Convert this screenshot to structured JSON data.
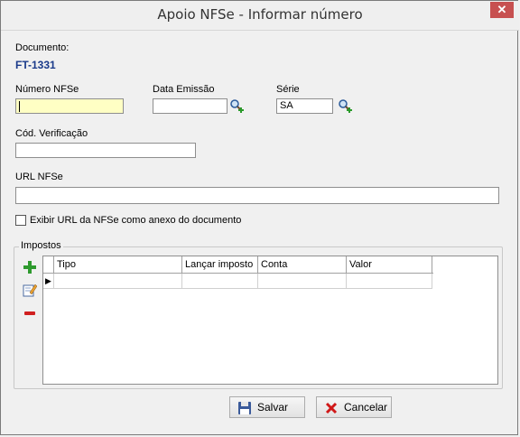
{
  "window": {
    "title": "Apoio NFSe - Informar número",
    "close_symbol": "✕"
  },
  "documento": {
    "label": "Documento:",
    "value": "FT-1331"
  },
  "numero_nfse": {
    "label": "Número NFSe",
    "value": ""
  },
  "data_emissao": {
    "label": "Data Emissão",
    "value": ""
  },
  "serie": {
    "label": "Série",
    "value": "SA"
  },
  "cod_verificacao": {
    "label": "Cód. Verificação",
    "value": ""
  },
  "url_nfse": {
    "label": "URL NFSe",
    "value": ""
  },
  "exibir_url": {
    "label": "Exibir URL da NFSe como anexo do documento",
    "checked": false
  },
  "impostos": {
    "label": "Impostos",
    "columns": [
      "Tipo",
      "Lançar imposto",
      "Conta",
      "Valor"
    ],
    "rows": [
      [
        "",
        "",
        "",
        ""
      ]
    ],
    "row_indicator": "▶"
  },
  "buttons": {
    "salvar": "Salvar",
    "cancelar": "Cancelar"
  },
  "colors": {
    "accent_text": "#1a3a8a",
    "focus_field": "#ffffc4",
    "close": "#c75050"
  },
  "icons": {
    "lookup": "magnifier-plus-icon",
    "add": "plus-icon",
    "edit": "edit-icon",
    "remove": "minus-icon",
    "save": "floppy-icon",
    "cancel": "red-x-icon"
  }
}
